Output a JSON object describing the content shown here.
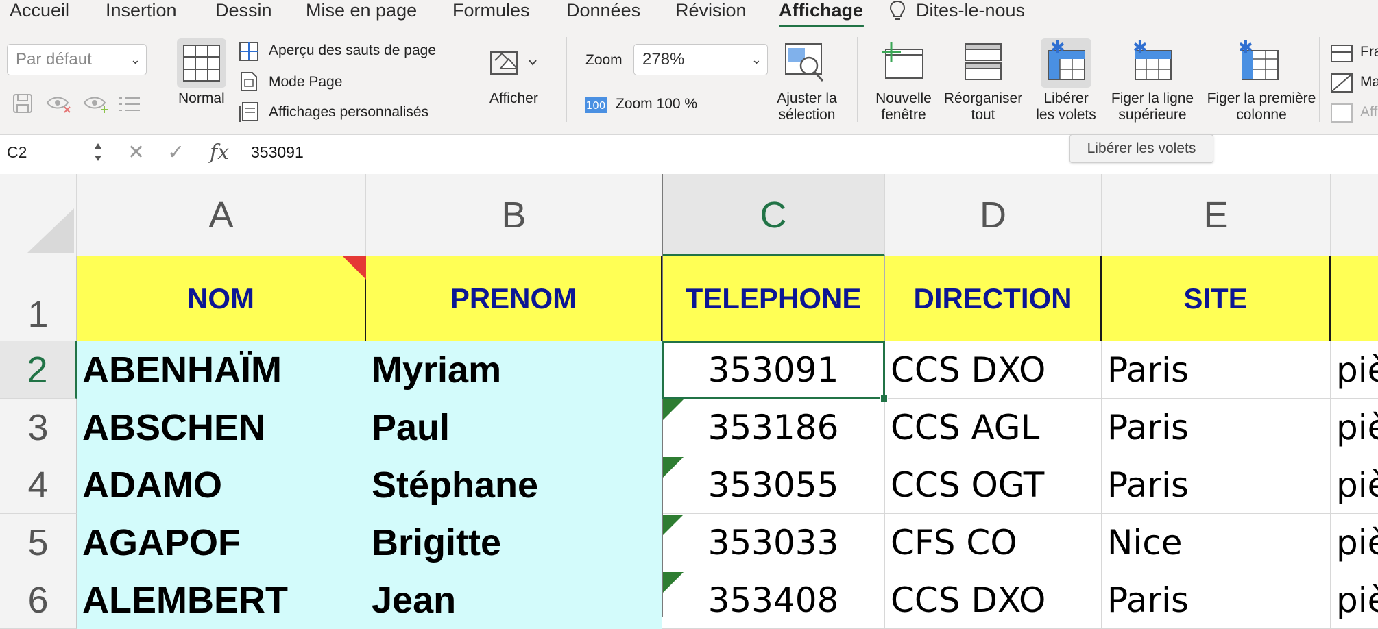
{
  "ribbon_tabs": [
    "Accueil",
    "Insertion",
    "Dessin",
    "Mise en page",
    "Formules",
    "Données",
    "Révision",
    "Affichage",
    "Dites-le-nous"
  ],
  "active_tab": "Affichage",
  "ribbon": {
    "view_select": "Par défaut",
    "normal_label": "Normal",
    "page_break_label": "Aperçu des sauts de page",
    "page_mode_label": "Mode Page",
    "custom_views_label": "Affichages personnalisés",
    "show_label": "Afficher",
    "zoom_label": "Zoom",
    "zoom_value": "278%",
    "zoom100_label": "Zoom 100 %",
    "fit_selection_label": [
      "Ajuster la",
      "sélection"
    ],
    "new_window_label": [
      "Nouvelle",
      "fenêtre"
    ],
    "arrange_all_label": [
      "Réorganiser",
      "tout"
    ],
    "unfreeze_label": [
      "Libérer",
      "les volets"
    ],
    "freeze_top_label": [
      "Figer la ligne",
      "supérieure"
    ],
    "freeze_first_col_label": [
      "Figer la première",
      "colonne"
    ],
    "right_cut": [
      "Fra",
      "Ma",
      "Aff"
    ]
  },
  "formula_bar": {
    "name_box": "C2",
    "cancel_symbol": "✕",
    "enter_symbol": "✓",
    "fx_symbol": "fx",
    "value": "353091"
  },
  "tooltip": "Libérer les volets",
  "grid": {
    "columns": [
      "A",
      "B",
      "C",
      "D",
      "E"
    ],
    "selected_column": "C",
    "rows": [
      "1",
      "2",
      "3",
      "4",
      "5",
      "6"
    ],
    "selected_row": "2",
    "headers": [
      "NOM",
      "PRENOM",
      "TELEPHONE",
      "DIRECTION",
      "SITE"
    ],
    "data": [
      {
        "nom": "ABENHAÏM",
        "prenom": "Myriam",
        "tel": "353091",
        "dir": "CCS DXO",
        "site": "Paris",
        "f": "piè"
      },
      {
        "nom": "ABSCHEN",
        "prenom": "Paul",
        "tel": "353186",
        "dir": "CCS AGL",
        "site": "Paris",
        "f": "piè"
      },
      {
        "nom": "ADAMO",
        "prenom": "Stéphane",
        "tel": "353055",
        "dir": "CCS OGT",
        "site": "Paris",
        "f": "piè"
      },
      {
        "nom": "AGAPOF",
        "prenom": "Brigitte",
        "tel": "353033",
        "dir": "CFS CO",
        "site": "Nice",
        "f": "piè"
      },
      {
        "nom": "ALEMBERT",
        "prenom": "Jean",
        "tel": "353408",
        "dir": "CCS DXO",
        "site": "Paris",
        "f": "piè"
      }
    ]
  },
  "colors": {
    "accent": "#217346",
    "header_fill": "#ffff55",
    "header_text": "#0c1694",
    "name_fill": "#d3fbfb"
  }
}
